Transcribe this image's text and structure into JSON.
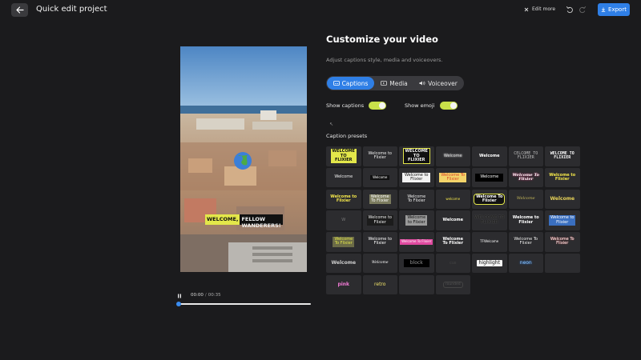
{
  "header": {
    "title": "Quick edit project",
    "edit_more_label": "Edit more",
    "export_label": "Export",
    "back_icon": "arrow-left-icon",
    "undo_icon": "undo-icon",
    "redo_icon": "redo-icon"
  },
  "player": {
    "caption_part1": "WELCOME,",
    "caption_part2": "FELLOW WANDERERS!",
    "current_time": "00:00",
    "separator": "/",
    "duration": "00:35",
    "progress": 0
  },
  "panel": {
    "heading": "Customize your video",
    "subheading": "Adjust captions style, media and voiceovers.",
    "tabs": [
      {
        "label": "Captions",
        "active": true
      },
      {
        "label": "Media",
        "active": false
      },
      {
        "label": "Voiceover",
        "active": false
      }
    ],
    "show_captions_label": "Show captions",
    "show_captions_on": true,
    "show_emoji_label": "Show emoji",
    "show_emoji_on": true,
    "presets_label": "Caption presets"
  },
  "presets": [
    {
      "text": "WELCOME\nTO\nFLIXIER",
      "style": "yellow-bold"
    },
    {
      "text": "Welcome to\nFlixier",
      "style": "plain-small"
    },
    {
      "text": "WELCOME\nTO\nFLIXIER",
      "style": "yellow-bold-2"
    },
    {
      "text": "Welcome",
      "style": "faint-glow"
    },
    {
      "text": "Welcome",
      "style": "white-small"
    },
    {
      "text": "CELCOME TO\nFLIXIER",
      "style": "mono-grey"
    },
    {
      "text": "WELCOME TO\nFLIXIER",
      "style": "mono-white"
    },
    {
      "text": "Welcome",
      "style": "plain"
    },
    {
      "text": "Welcome",
      "style": "tiny-black"
    },
    {
      "text": "Welcome to\nFlixier",
      "style": "white-box"
    },
    {
      "text": "Welcome To\nFlixier",
      "style": "yellow-box"
    },
    {
      "text": "Welcome",
      "style": "black-box"
    },
    {
      "text": "Welcome To\nFlixier",
      "style": "script-pink"
    },
    {
      "text": "Welcome to\nFlixier",
      "style": "yellow-highlight"
    },
    {
      "text": "Welcome to\nFlixier",
      "style": "yellow-word"
    },
    {
      "text": "Welcome\nTo Flixier",
      "style": "grey-box"
    },
    {
      "text": "Welcome\nTo Flixier",
      "style": "plain"
    },
    {
      "text": "welcome",
      "style": "tiny-yellow"
    },
    {
      "text": "Welcome To\nFlixier",
      "style": "yellow-pill"
    },
    {
      "text": "Welcome",
      "style": "script-yellow"
    },
    {
      "text": "Welcome",
      "style": "bold-yellow"
    },
    {
      "text": "W",
      "style": "faint"
    },
    {
      "text": "Welcome to\nFlixier",
      "style": "dark-plain"
    },
    {
      "text": "Welcome\nto Flixier",
      "style": "grey-stack"
    },
    {
      "text": "Welcome",
      "style": "white-small"
    },
    {
      "text": "WELCOME TO\nFLIXIER",
      "style": "dark-shadow"
    },
    {
      "text": "Welcome to\nFlixier",
      "style": "blue-word"
    },
    {
      "text": "Welcome to\nFlixier",
      "style": "blue-box"
    },
    {
      "text": "Welcome\nTo Flixier",
      "style": "yellow-outline"
    },
    {
      "text": "Welcome to\nFlixier",
      "style": "white-yellow"
    },
    {
      "text": "Welcome To Flixier",
      "style": "pink-box"
    },
    {
      "text": "Welcome\nTo Flixier",
      "style": "white-bold"
    },
    {
      "text": "TFWelcome",
      "style": "white-tiny"
    },
    {
      "text": "Welcome To\nFlixier",
      "style": "white-outline"
    },
    {
      "text": "Welcome To\nFlixier",
      "style": "red-outline"
    },
    {
      "text": "Welcome",
      "style": "grey-bold"
    },
    {
      "text": "Welcome",
      "style": "script-white"
    },
    {
      "text": "block",
      "style": "black-block"
    },
    {
      "text": "cus",
      "style": "faint-dark"
    },
    {
      "text": "highlight",
      "style": "white-highlight"
    },
    {
      "text": "neon",
      "style": "neon-blue"
    },
    {
      "text": "",
      "style": "empty"
    },
    {
      "text": "pink",
      "style": "pink-text"
    },
    {
      "text": "retro",
      "style": "retro-yellow"
    },
    {
      "text": "",
      "style": "empty"
    },
    {
      "text": "rounded",
      "style": "rounded-grey"
    }
  ],
  "colors": {
    "accent": "#2f7fe6",
    "toggle_on": "#c9e04a",
    "caption_yellow": "#e3e74a",
    "background": "#1b1b1d"
  }
}
